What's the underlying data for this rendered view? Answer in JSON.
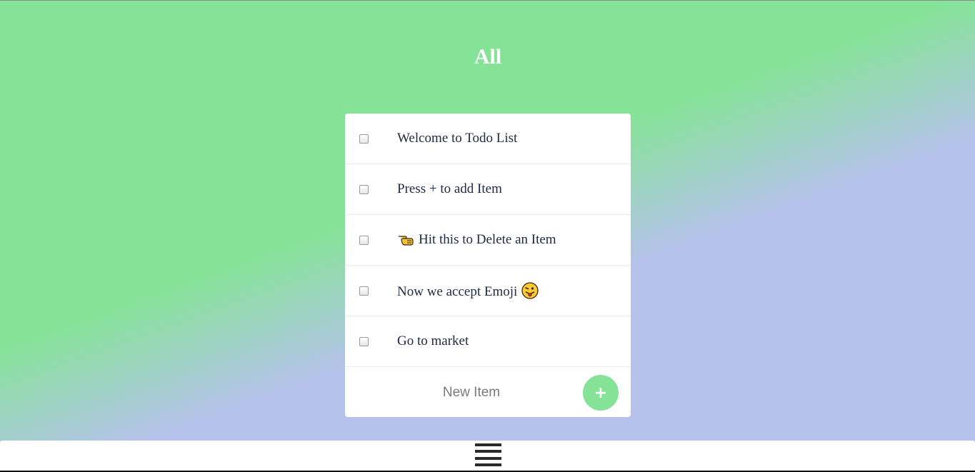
{
  "header": {
    "title": "All"
  },
  "todo": {
    "items": [
      {
        "label": "Welcome to Todo List",
        "checked": false
      },
      {
        "label": "Press + to add Item",
        "checked": false
      },
      {
        "label": "Hit this to Delete an Item",
        "checked": false,
        "icon": "pointing-hand-icon"
      },
      {
        "label": "Now we accept Emoji",
        "checked": false,
        "icon": "tongue-face-emoji-icon"
      },
      {
        "label": "Go to market",
        "checked": false
      }
    ],
    "new_item": {
      "placeholder": "New Item",
      "value": ""
    },
    "add_button_label": "+"
  },
  "footer": {
    "menu_icon": "hamburger-menu-icon"
  },
  "colors": {
    "accent": "#85e397",
    "background_top": "#b6c2ec",
    "background_bottom": "#85e397",
    "text": "#1c2b43"
  }
}
